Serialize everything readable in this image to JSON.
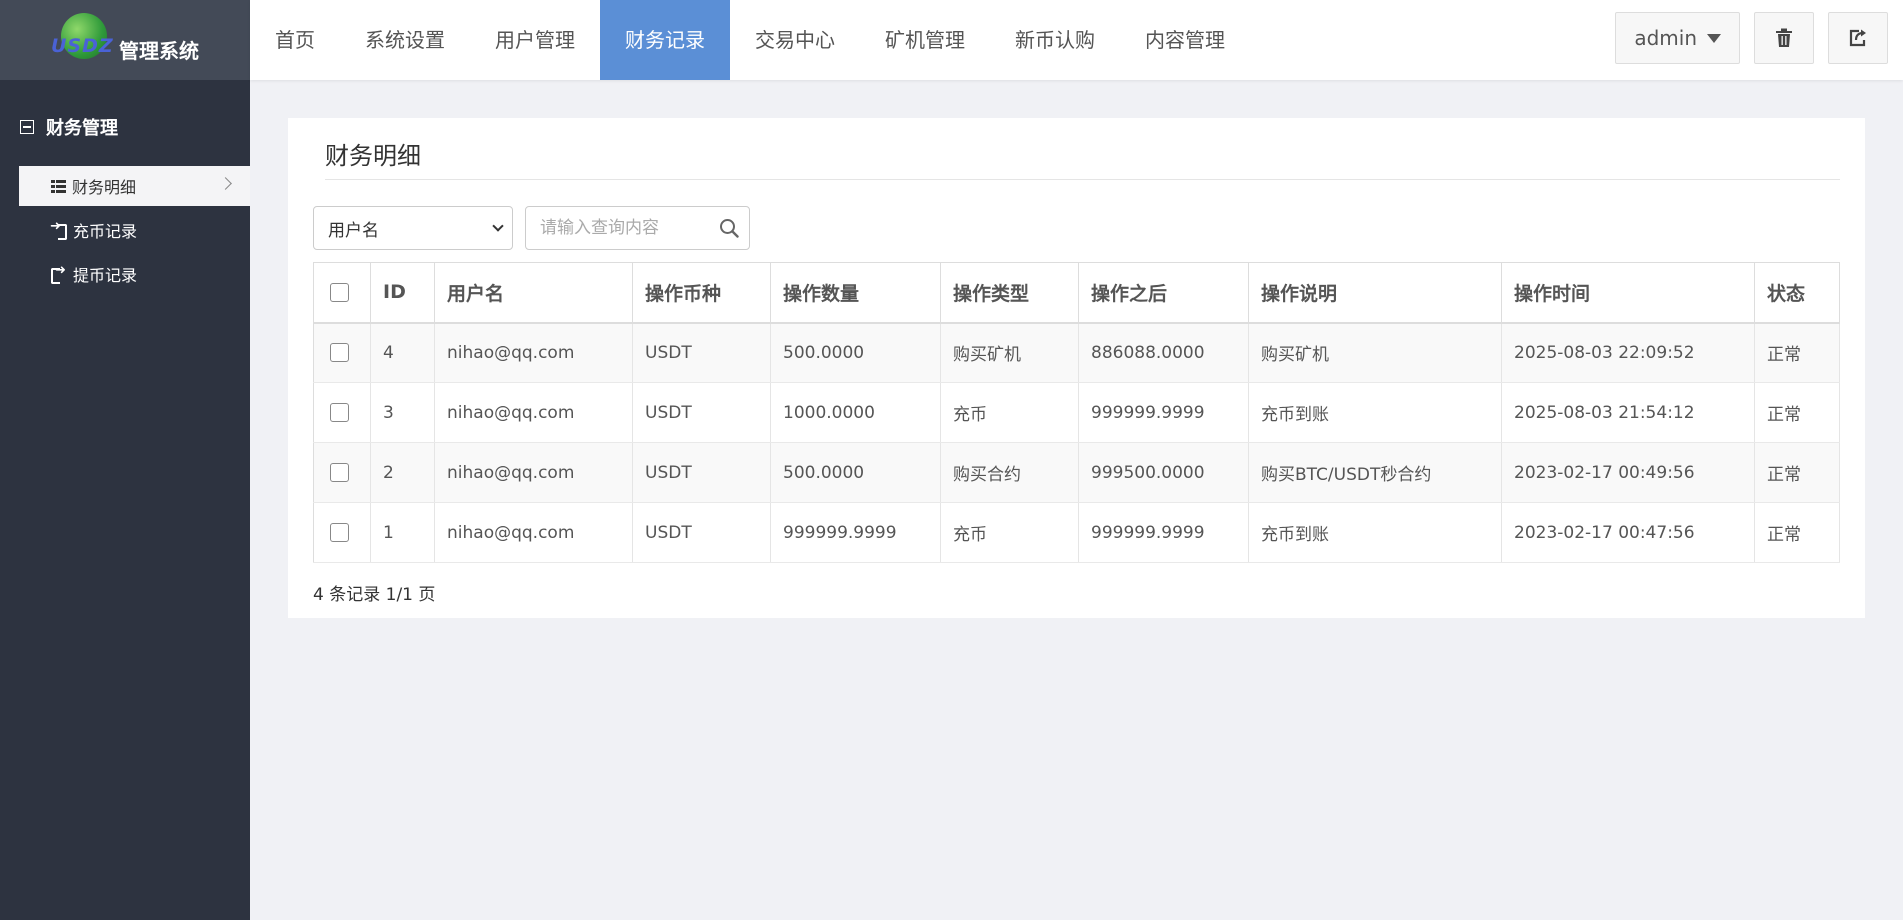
{
  "brand": {
    "logo_mark": "USDZ",
    "title": "管理系统"
  },
  "nav": {
    "items": [
      "首页",
      "系统设置",
      "用户管理",
      "财务记录",
      "交易中心",
      "矿机管理",
      "新币认购",
      "内容管理"
    ],
    "active_index": 3
  },
  "user_menu": {
    "label": "admin"
  },
  "sidebar": {
    "group_title": "财务管理",
    "items": [
      {
        "label": "财务明细",
        "icon": "list-icon",
        "active": true
      },
      {
        "label": "充币记录",
        "icon": "sign-in-icon",
        "active": false
      },
      {
        "label": "提币记录",
        "icon": "sign-out-icon",
        "active": false
      }
    ]
  },
  "panel": {
    "title": "财务明细",
    "filter_select_value": "用户名",
    "search_placeholder": "请输入查询内容"
  },
  "table": {
    "columns": [
      "ID",
      "用户名",
      "操作币种",
      "操作数量",
      "操作类型",
      "操作之后",
      "操作说明",
      "操作时间",
      "状态"
    ],
    "rows": [
      [
        "4",
        "nihao@qq.com",
        "USDT",
        "500.0000",
        "购买矿机",
        "886088.0000",
        "购买矿机",
        "2025-08-03 22:09:52",
        "正常"
      ],
      [
        "3",
        "nihao@qq.com",
        "USDT",
        "1000.0000",
        "充币",
        "999999.9999",
        "充币到账",
        "2025-08-03 21:54:12",
        "正常"
      ],
      [
        "2",
        "nihao@qq.com",
        "USDT",
        "500.0000",
        "购买合约",
        "999500.0000",
        "购买BTC/USDT秒合约",
        "2023-02-17 00:49:56",
        "正常"
      ],
      [
        "1",
        "nihao@qq.com",
        "USDT",
        "999999.9999",
        "充币",
        "999999.9999",
        "充币到账",
        "2023-02-17 00:47:56",
        "正常"
      ]
    ]
  },
  "pager": {
    "text": "4 条记录 1/1 页"
  },
  "colors": {
    "sidebar_bg": "#2d3340",
    "logo_bg": "#434a57",
    "nav_active": "#5b8fd6",
    "page_bg": "#f0f1f5"
  }
}
